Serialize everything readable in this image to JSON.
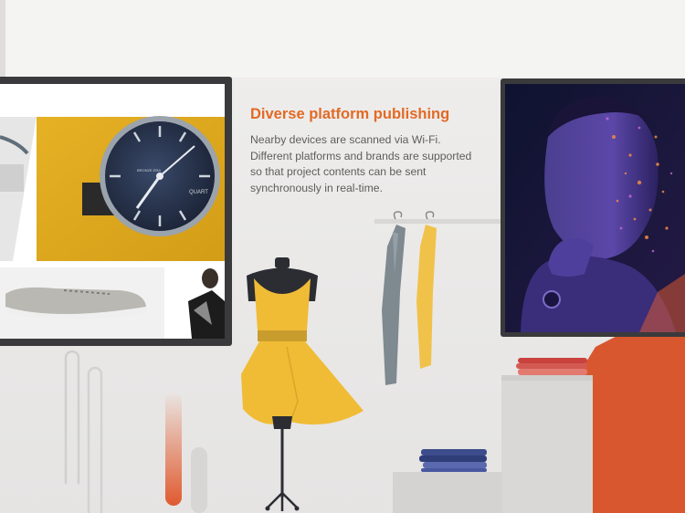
{
  "feature": {
    "title": "Diverse platform publishing",
    "description": "Nearby devices are scanned via Wi-Fi. Different platforms and brands are supported so that project contents can be sent synchronously in real-time."
  },
  "left_screen": {
    "watch_dial_text_1": "QUART",
    "watch_dial_text_2": "BRONZE ERA"
  },
  "colors": {
    "accent": "#e36a25",
    "body_text": "#5d5d5d",
    "dress_yellow": "#f0bc35",
    "orange_panel": "#d8572f",
    "frame_dark": "#3a3a3c"
  }
}
